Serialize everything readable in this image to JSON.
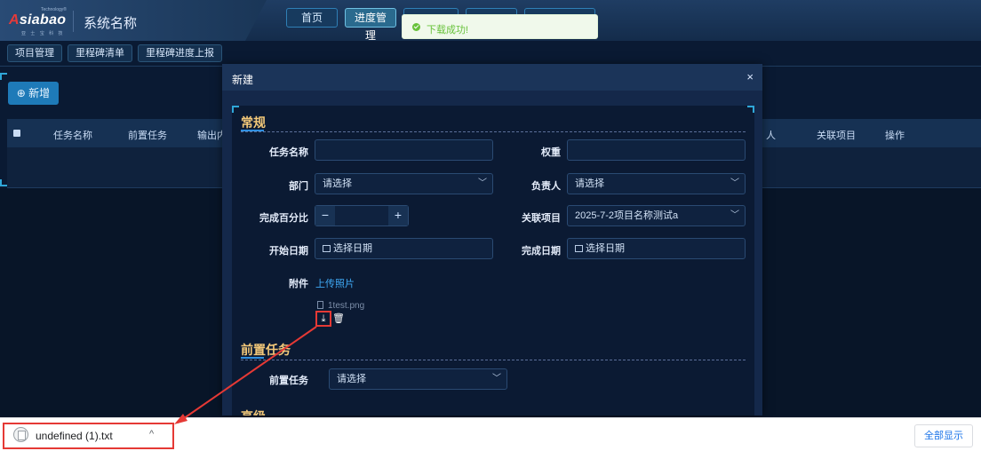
{
  "header": {
    "logo_top_text": "Technology®",
    "logo_brand_prefix": "A",
    "logo_brand_rest": "siabao",
    "logo_sub_text": "亚 士 宝 科 技",
    "system_title": "系统名称",
    "nav": [
      "首页",
      "进度管理",
      "",
      "",
      ""
    ]
  },
  "subnav": [
    "项目管理",
    "里程碑清单",
    "里程碑进度上报"
  ],
  "page": {
    "new_button": "⊕ 新增",
    "table_headers_left": [
      "任务名称",
      "前置任务",
      "输出内"
    ],
    "table_headers_right": [
      "人",
      "关联项目",
      "操作"
    ]
  },
  "toast": {
    "text": "下载成功!",
    "color": "#67c23a"
  },
  "modal": {
    "title": "新建",
    "close": "×",
    "section_general": "常规",
    "section_pre": "前置任务",
    "section_next": "高级",
    "fields": {
      "task_name_label": "任务名称",
      "task_name_value": "",
      "weight_label": "权重",
      "weight_value": "",
      "dept_label": "部门",
      "dept_placeholder": "请选择",
      "owner_label": "负责人",
      "owner_placeholder": "请选择",
      "percent_label": "完成百分比",
      "percent_minus": "−",
      "percent_plus": "+",
      "project_label": "关联项目",
      "project_value": "2025-7-2项目名称测试a",
      "start_label": "开始日期",
      "start_placeholder": "选择日期",
      "end_label": "完成日期",
      "end_placeholder": "选择日期",
      "attachment_label": "附件",
      "upload_link": "上传照片",
      "file_name": "1test.png",
      "pre_task_label": "前置任务",
      "pre_task_placeholder": "请选择"
    }
  },
  "download_bar": {
    "file_name": "undefined (1).txt",
    "chevron": "^",
    "show_all": "全部显示"
  },
  "colors": {
    "accent_blue": "#3fa9f5",
    "section_title": "#f2c879",
    "highlight_red": "#e53935",
    "background": "#0a1a33"
  }
}
